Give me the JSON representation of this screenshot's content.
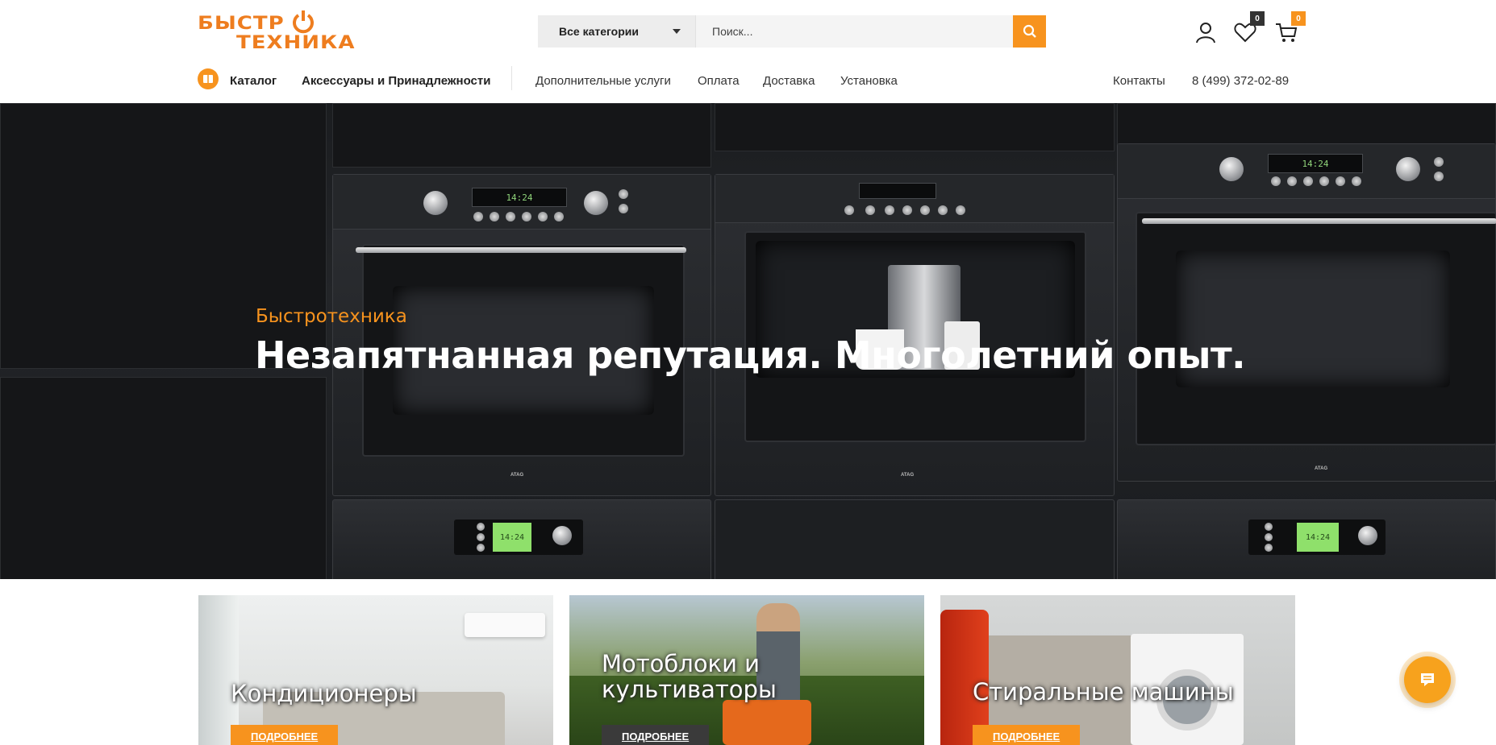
{
  "brand": {
    "line1": "БЫСТР",
    "line2": "ТЕХНИКА",
    "accent": "#f7931e"
  },
  "search": {
    "category_label": "Все категории",
    "placeholder": "Поиск..."
  },
  "header_icons": {
    "wishlist_count": "0",
    "cart_count": "0"
  },
  "nav": {
    "catalog": "Каталог",
    "accessories": "Аксессуары и Принадлежности",
    "services": "Дополнительные услуги",
    "payment": "Оплата",
    "delivery": "Доставка",
    "installation": "Установка",
    "contacts": "Контакты",
    "phone": "8 (499) 372-02-89"
  },
  "hero": {
    "subtitle": "Быстротехника",
    "title": "Незапятнанная репутация. Многолетний опыт.",
    "display_time": "14:24",
    "oven_brand": "ATAG"
  },
  "categories": [
    {
      "title": "Кондиционеры",
      "button": "ПОДРОБНЕЕ"
    },
    {
      "title": "Мотоблоки и культиваторы",
      "button": "ПОДРОБНЕЕ"
    },
    {
      "title": "Стиральные машины",
      "button": "ПОДРОБНЕЕ"
    }
  ]
}
